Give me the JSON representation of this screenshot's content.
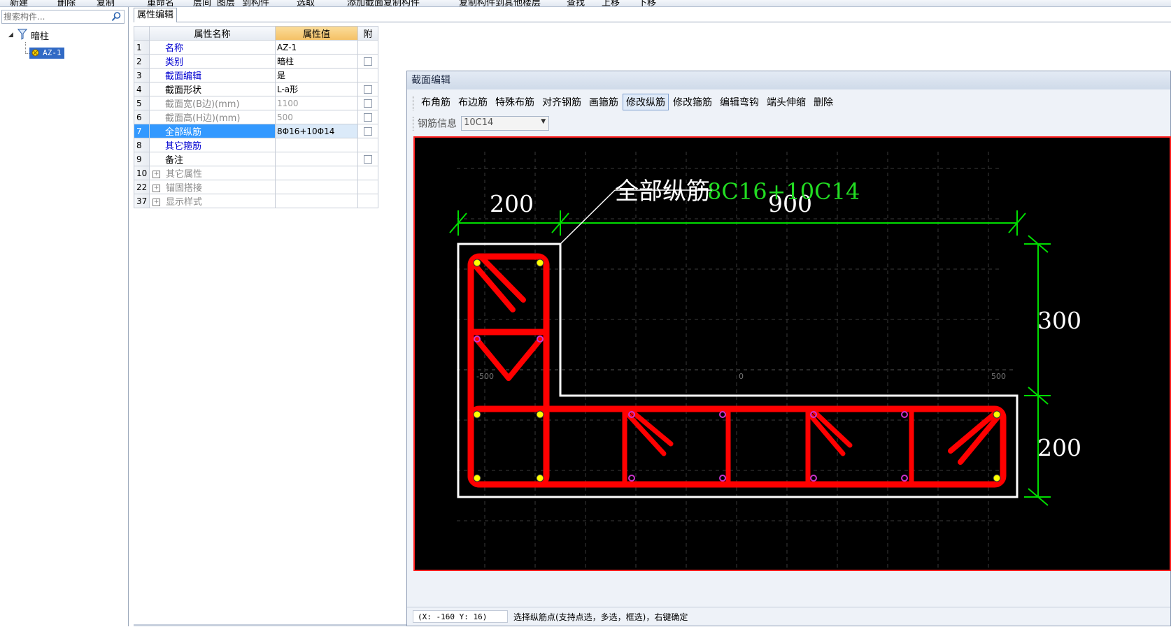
{
  "top_toolbar": {
    "items": [
      "新建",
      "删除",
      "复制",
      "重命名",
      "层间",
      "图层",
      "到构件",
      "选取",
      "添加截面复制构件",
      "复制构件到其他楼层",
      "查找",
      "上移",
      "下移"
    ]
  },
  "left_panel": {
    "search_placeholder": "搜索构件...",
    "tree": {
      "root_label": "暗柱",
      "child_label": "AZ-1"
    }
  },
  "property_panel": {
    "tab_label": "属性编辑",
    "headers": {
      "num": "",
      "name": "属性名称",
      "value": "属性值",
      "attach": "附"
    },
    "rows": [
      {
        "num": "1",
        "name": "名称",
        "value": "AZ-1",
        "name_style": "blue",
        "value_style": "",
        "checkbox": false,
        "expand": false,
        "selected": false
      },
      {
        "num": "2",
        "name": "类别",
        "value": "暗柱",
        "name_style": "blue",
        "value_style": "",
        "checkbox": true,
        "expand": false,
        "selected": false
      },
      {
        "num": "3",
        "name": "截面编辑",
        "value": "是",
        "name_style": "blue",
        "value_style": "",
        "checkbox": false,
        "expand": false,
        "selected": false
      },
      {
        "num": "4",
        "name": "截面形状",
        "value": "L-a形",
        "name_style": "",
        "value_style": "",
        "checkbox": true,
        "expand": false,
        "selected": false
      },
      {
        "num": "5",
        "name": "截面宽(B边)(mm)",
        "value": "1100",
        "name_style": "gray",
        "value_style": "gray",
        "checkbox": true,
        "expand": false,
        "selected": false
      },
      {
        "num": "6",
        "name": "截面高(H边)(mm)",
        "value": "500",
        "name_style": "gray",
        "value_style": "gray",
        "checkbox": true,
        "expand": false,
        "selected": false
      },
      {
        "num": "7",
        "name": "全部纵筋",
        "value": "8Φ16+10Φ14",
        "name_style": "",
        "value_style": "",
        "checkbox": true,
        "expand": false,
        "selected": true
      },
      {
        "num": "8",
        "name": "其它箍筋",
        "value": "",
        "name_style": "blue",
        "value_style": "",
        "checkbox": false,
        "expand": false,
        "selected": false
      },
      {
        "num": "9",
        "name": "备注",
        "value": "",
        "name_style": "",
        "value_style": "",
        "checkbox": true,
        "expand": false,
        "selected": false
      },
      {
        "num": "10",
        "name": "其它属性",
        "value": "",
        "name_style": "gray",
        "value_style": "",
        "checkbox": false,
        "expand": true,
        "selected": false
      },
      {
        "num": "22",
        "name": "锚固搭接",
        "value": "",
        "name_style": "gray",
        "value_style": "",
        "checkbox": false,
        "expand": true,
        "selected": false
      },
      {
        "num": "37",
        "name": "显示样式",
        "value": "",
        "name_style": "gray",
        "value_style": "",
        "checkbox": false,
        "expand": true,
        "selected": false
      }
    ]
  },
  "section_editor": {
    "title": "截面编辑",
    "toolbar": [
      {
        "label": "布角筋",
        "active": false
      },
      {
        "label": "布边筋",
        "active": false
      },
      {
        "label": "特殊布筋",
        "active": false
      },
      {
        "label": "对齐钢筋",
        "active": false
      },
      {
        "label": "画箍筋",
        "active": false
      },
      {
        "label": "修改纵筋",
        "active": true
      },
      {
        "label": "修改箍筋",
        "active": false
      },
      {
        "label": "编辑弯钩",
        "active": false
      },
      {
        "label": "端头伸缩",
        "active": false
      },
      {
        "label": "删除",
        "active": false
      }
    ],
    "rebar_info_label": "钢筋信息",
    "rebar_info_value": "10C14",
    "canvas": {
      "annotation_label": "全部纵筋",
      "annotation_value": "8C16+10C14",
      "dim_top_left": "200",
      "dim_top_right": "900",
      "dim_right_top": "300",
      "dim_right_bottom": "200",
      "axis_minus": "-500",
      "axis_zero": "0",
      "axis_plus": "500",
      "colors": {
        "background": "#000000",
        "rebar": "#ff0000",
        "outline": "#ffffff",
        "dimension": "#00dd00",
        "corner_bar": "#ffff00",
        "edge_bar": "#cc33cc"
      }
    },
    "status": {
      "coords": "(X: -160 Y: 16)",
      "hint": "选择纵筋点(支持点选，多选，框选)，右键确定"
    }
  }
}
